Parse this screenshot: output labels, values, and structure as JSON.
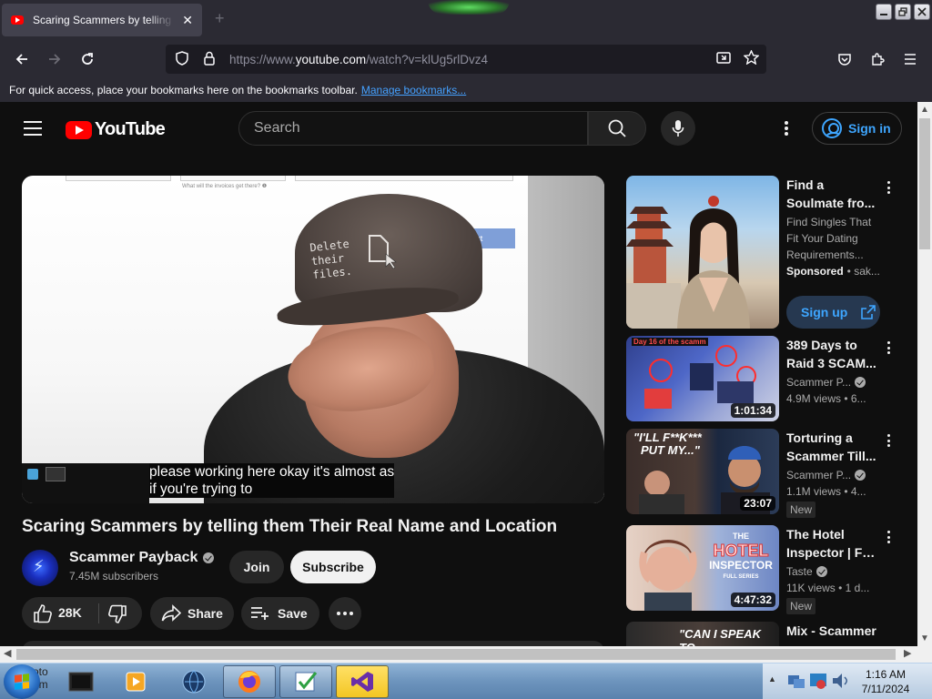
{
  "browser": {
    "tab_title": "Scaring Scammers by telling them Their Real Name and Location",
    "tab_close": "✕",
    "new_tab": "+",
    "url_prefix": "https://www.",
    "url_domain": "youtube.com",
    "url_path": "/watch?v=klUg5rlDvz4",
    "bookmarks_text": "For quick access, place your bookmarks here on the bookmarks toolbar.",
    "bookmarks_link": "Manage bookmarks..."
  },
  "youtube": {
    "logo_text": "YouTube",
    "search_placeholder": "Search",
    "sign_in": "Sign in",
    "video": {
      "cap_text": "Delete\ntheir\nfiles.",
      "overlay_button": "Next",
      "overlay_hint": "What will the invoices get there? ❶",
      "caption_line1": "please working here okay it's almost as",
      "caption_line2": "if you're trying to",
      "title": "Scaring Scammers by telling them Their Real Name and Location",
      "channel": "Scammer Payback",
      "subscribers": "7.45M subscribers",
      "join": "Join",
      "subscribe": "Subscribe",
      "likes": "28K",
      "share": "Share",
      "save": "Save"
    },
    "recommendations": [
      {
        "title1": "Find a",
        "title2": "Soulmate fro...",
        "line1": "Find Singles That",
        "line2": "Fit Your Dating",
        "line3": "Requirements...",
        "sponsored": "Sponsored",
        "sponsor_rest": "• sak...",
        "cta": "Sign up"
      },
      {
        "title1": "389 Days to",
        "title2": "Raid 3 SCAM...",
        "channel": "Scammer P...",
        "stats": "4.9M views • 6...",
        "duration": "1:01:34",
        "thumb_banner": "Day 16 of the scamm"
      },
      {
        "title1": "Torturing a",
        "title2": "Scammer Till...",
        "channel": "Scammer P...",
        "stats": "1.1M views • 4...",
        "duration": "23:07",
        "badge": "New",
        "thumb_text1": "\"I'LL F**K***",
        "thumb_text2": "PUT MY...\""
      },
      {
        "title1": "The Hotel",
        "title2": "Inspector | Ful...",
        "channel": "Taste",
        "stats": "11K views • 1 d...",
        "duration": "4:47:32",
        "badge": "New",
        "thumb_text1": "THE",
        "thumb_text2": "HOTEL",
        "thumb_text3": "INSPECTOR",
        "thumb_text4": "FULL SERIES"
      },
      {
        "title1": "Mix - Scammer",
        "thumb_text1": "\"CAN I SPEAK",
        "thumb_text2": "TO"
      }
    ]
  },
  "taskbar": {
    "time": "1:16 AM",
    "date": "7/11/2024",
    "partial_text_1": "oto",
    "partial_text_2": "om"
  },
  "colors": {
    "yt_bg": "#0f0f0f",
    "yt_red": "#ff0000",
    "link_blue": "#3ea6ff",
    "firefox_chrome": "#2b2a33"
  }
}
